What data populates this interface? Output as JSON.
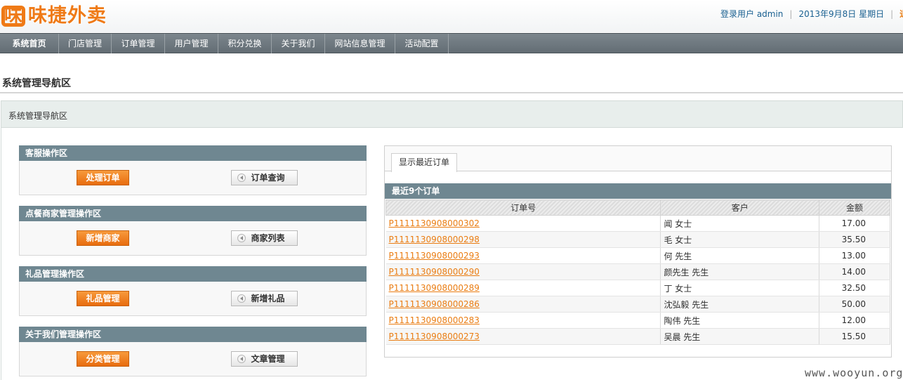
{
  "header": {
    "logo_glyph": "味",
    "logo_text": "味捷外卖",
    "user_label": "登录用户 admin",
    "date_text": "2013年9月8日 星期日",
    "logout_label": "退出"
  },
  "nav": {
    "items": [
      "系统首页",
      "门店管理",
      "订单管理",
      "用户管理",
      "积分兑换",
      "关于我们",
      "网站信息管理",
      "活动配置"
    ]
  },
  "page": {
    "title": "系统管理导航区",
    "breadcrumb": "系统管理导航区"
  },
  "sections": [
    {
      "title": "客服操作区",
      "primary": "处理订单",
      "secondary": "订单查询"
    },
    {
      "title": "点餐商家管理操作区",
      "primary": "新增商家",
      "secondary": "商家列表"
    },
    {
      "title": "礼品管理操作区",
      "primary": "礼品管理",
      "secondary": "新增礼品"
    },
    {
      "title": "关于我们管理操作区",
      "primary": "分类管理",
      "secondary": "文章管理"
    }
  ],
  "orders": {
    "tab_label": "显示最近订单",
    "grid_title": "最近9个订单",
    "columns": [
      "订单号",
      "客户",
      "金额"
    ],
    "rows": [
      {
        "id": "P1111130908000302",
        "customer": "闻 女士",
        "amount": "17.00"
      },
      {
        "id": "P1111130908000298",
        "customer": "毛 女士",
        "amount": "35.50"
      },
      {
        "id": "P1111130908000293",
        "customer": "何 先生",
        "amount": "13.00"
      },
      {
        "id": "P1111130908000290",
        "customer": "颜先生 先生",
        "amount": "14.00"
      },
      {
        "id": "P1111130908000289",
        "customer": "丁 女士",
        "amount": "32.50"
      },
      {
        "id": "P1111130908000286",
        "customer": "沈弘毅 先生",
        "amount": "50.00"
      },
      {
        "id": "P1111130908000283",
        "customer": "陶伟 先生",
        "amount": "12.00"
      },
      {
        "id": "P1111130908000273",
        "customer": "吴晨 先生",
        "amount": "15.50"
      }
    ]
  },
  "watermark": "www.wooyun.org"
}
